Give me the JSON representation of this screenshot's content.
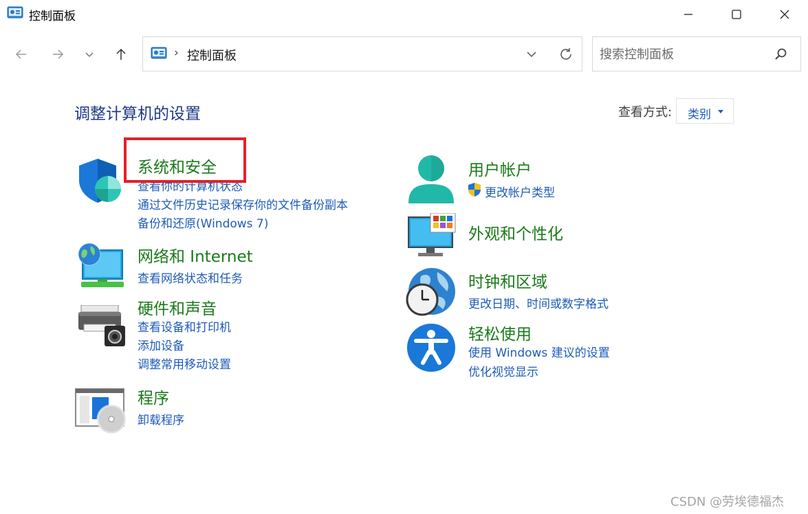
{
  "window": {
    "title": "控制面板",
    "icon": "control-panel-icon",
    "controls": [
      "minimize-icon",
      "maximize-icon",
      "close-icon"
    ]
  },
  "nav": {
    "back_icon": "arrow-left-icon",
    "forward_icon": "arrow-right-icon",
    "recent_icon": "chevron-down-icon",
    "up_icon": "arrow-up-icon"
  },
  "address": {
    "separator": "›",
    "path": "控制面板"
  },
  "search": {
    "placeholder": "搜索控制面板"
  },
  "main": {
    "title": "调整计算机的设置",
    "view_by_label": "查看方式:",
    "view_by_value": "类别"
  },
  "categories": {
    "system": {
      "title": "系统和安全",
      "icon": "shield-icon",
      "links": [
        "查看你的计算机状态",
        "通过文件历史记录保存你的文件备份副本",
        "备份和还原(Windows 7)"
      ]
    },
    "network": {
      "title": "网络和 Internet",
      "icon": "network-globe-icon",
      "links": [
        "查看网络状态和任务"
      ]
    },
    "hardware": {
      "title": "硬件和声音",
      "icon": "printer-icon",
      "links": [
        "查看设备和打印机",
        "添加设备",
        "调整常用移动设置"
      ]
    },
    "programs": {
      "title": "程序",
      "icon": "programs-disc-icon",
      "links": [
        "卸载程序"
      ]
    },
    "users": {
      "title": "用户帐户",
      "icon": "user-avatar-icon",
      "links": [
        "更改帐户类型"
      ],
      "link_icon": "uac-shield-icon"
    },
    "appearance": {
      "title": "外观和个性化",
      "icon": "monitor-icon",
      "links": []
    },
    "clock": {
      "title": "时钟和区域",
      "icon": "clock-globe-icon",
      "links": [
        "更改日期、时间或数字格式"
      ]
    },
    "ease": {
      "title": "轻松使用",
      "icon": "accessibility-icon",
      "links": [
        "使用 Windows 建议的设置",
        "优化视觉显示"
      ]
    }
  },
  "watermark": "CSDN @劳埃德福杰",
  "colors": {
    "category_title": "#1a7a1a",
    "link": "#1e5bb8",
    "heading": "#1e3a87",
    "highlight": "#e2202a"
  }
}
